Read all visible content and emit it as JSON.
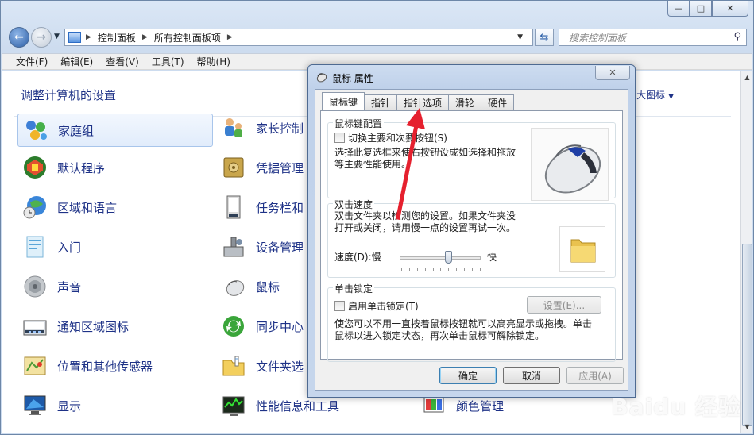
{
  "window": {
    "caption_buttons": [
      "—",
      "□",
      "✕"
    ]
  },
  "navbar": {
    "breadcrumb": [
      "控制面板",
      "所有控制面板项"
    ],
    "search_placeholder": "搜索控制面板"
  },
  "menu": [
    "文件(F)",
    "编辑(E)",
    "查看(V)",
    "工具(T)",
    "帮助(H)"
  ],
  "content": {
    "heading": "调整计算机的设置",
    "view_selector": "大图标",
    "items_col1": [
      "家庭组",
      "默认程序",
      "区域和语言",
      "入门",
      "声音",
      "通知区域图标",
      "位置和其他传感器",
      "显示"
    ],
    "items_col2": [
      "家长控制",
      "凭据管理",
      "任务栏和",
      "设备管理",
      "鼠标",
      "同步中心",
      "文件夹选",
      "性能信息和工具"
    ],
    "items_col3": [
      "颜色管理"
    ]
  },
  "dialog": {
    "title": "鼠标 属性",
    "close": "✕",
    "tabs": [
      "鼠标键",
      "指针",
      "指针选项",
      "滑轮",
      "硬件"
    ],
    "button_config": {
      "title": "鼠标键配置",
      "checkbox": "切换主要和次要按钮(S)",
      "desc_line1": "选择此复选框来使右按钮设成如选择和拖放",
      "desc_line2": "等主要性能使用。"
    },
    "double_click": {
      "title": "双击速度",
      "desc_line1": "双击文件夹以检测您的设置。如果文件夹没",
      "desc_line2": "打开或关闭，请用慢一点的设置再试一次。",
      "speed_label": "速度(D):慢",
      "fast_label": "快",
      "speed_value": 0.6
    },
    "click_lock": {
      "title": "单击锁定",
      "checkbox": "启用单击锁定(T)",
      "settings_button": "设置(E)...",
      "desc_line1": "使您可以不用一直按着鼠标按钮就可以高亮显示或拖拽。单击",
      "desc_line2": "鼠标以进入锁定状态，再次单击鼠标可解除锁定。"
    },
    "ok": "确定",
    "cancel": "取消",
    "apply": "应用(A)"
  },
  "watermark": {
    "line1": "Baidu 经验",
    "line2": "jingyan.baidu.com"
  }
}
